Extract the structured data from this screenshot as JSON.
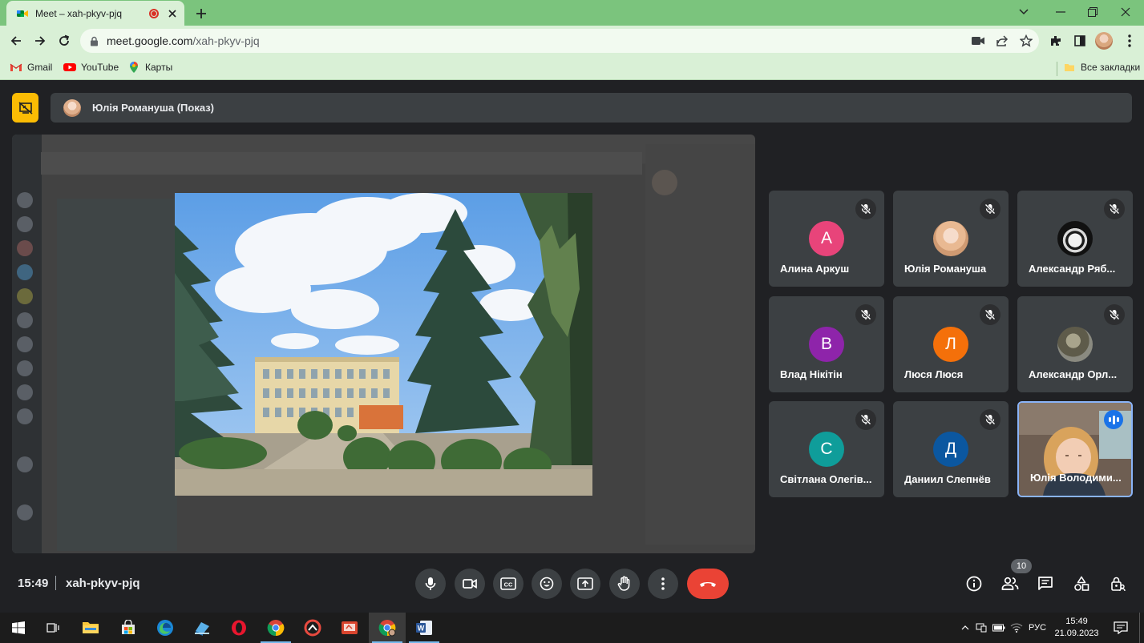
{
  "browser": {
    "tab_title": "Meet – xah-pkyv-pjq",
    "url_host": "meet.google.com",
    "url_path": "/xah-pkyv-pjq"
  },
  "bookmarks": [
    {
      "label": "Gmail",
      "icon": "gmail-icon"
    },
    {
      "label": "YouTube",
      "icon": "youtube-icon"
    },
    {
      "label": "Карты",
      "icon": "maps-icon"
    }
  ],
  "all_bookmarks_label": "Все закладки",
  "presenter": {
    "name": "Юлія Романуша (Показ)"
  },
  "participants": [
    {
      "name": "Алина Аркуш",
      "initial": "А",
      "color": "#e8447a",
      "muted": true
    },
    {
      "name": "Юлія Романуша",
      "initial": "",
      "color": "#f3d5c3",
      "muted": true
    },
    {
      "name": "Александр Ряб...",
      "initial": "",
      "color": "#ffffff",
      "muted": true
    },
    {
      "name": "Влад Нікітін",
      "initial": "В",
      "color": "#8e24aa",
      "muted": true
    },
    {
      "name": "Люся Люся",
      "initial": "Л",
      "color": "#f4700a",
      "muted": true
    },
    {
      "name": "Александр Орл...",
      "initial": "",
      "color": "#6b6b5c",
      "muted": true
    },
    {
      "name": "Світлана Олегів...",
      "initial": "С",
      "color": "#0f9d9a",
      "muted": true
    },
    {
      "name": "Даниил Слепнёв",
      "initial": "Д",
      "color": "#0b57a0",
      "muted": true
    },
    {
      "name": "Юлія Володими...",
      "initial": "",
      "color": "#5a4d45",
      "muted": false,
      "speaking": true
    }
  ],
  "meeting": {
    "time": "15:49",
    "code": "xah-pkyv-pjq",
    "participant_count": "10"
  },
  "taskbar": {
    "language": "РУС",
    "time": "15:49",
    "date": "21.09.2023"
  },
  "colors": {
    "meet_bg": "#202124",
    "tile_bg": "#3c4043",
    "end_call": "#ea4335",
    "present_badge": "#fbbc04",
    "chrome_frame": "#7bc47d"
  }
}
